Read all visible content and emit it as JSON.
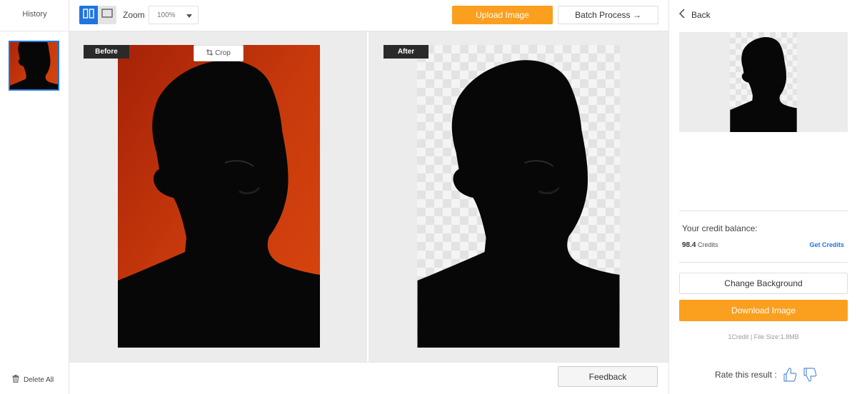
{
  "history": {
    "title": "History",
    "delete_all_label": "Delete All"
  },
  "toolbar": {
    "zoom_label": "Zoom",
    "zoom_value": "100%",
    "upload_label": "Upload Image",
    "batch_label": "Batch Process →"
  },
  "workspace": {
    "before_tag": "Before",
    "after_tag": "After",
    "crop_label": "Crop"
  },
  "bottombar": {
    "feedback_label": "Feedback"
  },
  "panel": {
    "back_label": "Back",
    "credit_label": "Your credit balance:",
    "credit_amount": "98.4",
    "credit_unit": "Credits",
    "get_credits_label": "Get Credits",
    "change_bg_label": "Change Background",
    "download_label": "Download Image",
    "file_info": "1Credit | File Size:1.8MB",
    "rate_label": "Rate this result :"
  },
  "colors": {
    "accent_blue": "#1f74e0",
    "accent_orange": "#fb9f1f",
    "original_background": "#c2380d"
  },
  "icons": [
    "split-view-icon",
    "single-view-icon",
    "chevron-down-icon",
    "crop-icon",
    "back-chevron-icon",
    "trash-icon",
    "thumbs-up-icon",
    "thumbs-down-icon"
  ]
}
